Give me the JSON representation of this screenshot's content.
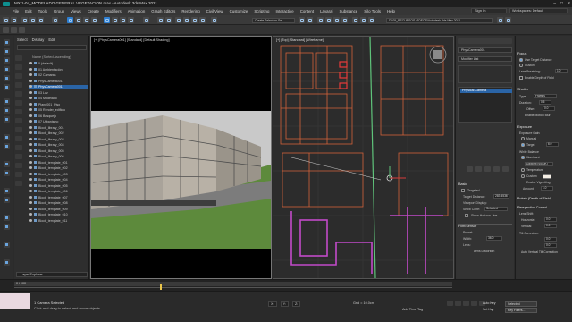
{
  "window": {
    "title": "MXI1-04_MODELADO GENERAL VEGETACION.max - Autodesk 3ds Max 2021"
  },
  "menu": [
    "File",
    "Edit",
    "Tools",
    "Group",
    "Views",
    "Create",
    "Modifiers",
    "Animation",
    "Graph Editors",
    "Rendering",
    "Civil View",
    "Customize",
    "Scripting",
    "Interactive",
    "Content",
    "Lavarai",
    "Substance",
    "Silo Tools",
    "Help"
  ],
  "header_controls": {
    "sign_in": "Sign In",
    "workspace": "Workspaces: Default"
  },
  "toolbar": {
    "selection_set": "Create Selection Set",
    "project_path": "D:\\05_RECURSOS VIDEOS\\Autodesk 3ds Max 2021"
  },
  "scene_explorer": {
    "tabs": [
      "Select",
      "Display",
      "Edit"
    ],
    "header": "Name (Sorted Ascending)",
    "rows": [
      {
        "label": "0 (default)",
        "selected": false
      },
      {
        "label": "01 Ambientación",
        "selected": false
      },
      {
        "label": "02 Cámaras",
        "selected": false
      },
      {
        "label": "PhysCamera001",
        "selected": false
      },
      {
        "label": "PhysCamera001",
        "selected": true
      },
      {
        "label": "03 Luz",
        "selected": false
      },
      {
        "label": "04 Modelado",
        "selected": false
      },
      {
        "label": "Plane001_Piso",
        "selected": false
      },
      {
        "label": "05 Render_edificio",
        "selected": false
      },
      {
        "label": "06 Bosquejo",
        "selected": false
      },
      {
        "label": "07 Urbanismo",
        "selected": false
      },
      {
        "label": "Block_library_001",
        "selected": false
      },
      {
        "label": "Block_library_002",
        "selected": false
      },
      {
        "label": "Block_library_003",
        "selected": false
      },
      {
        "label": "Block_library_004",
        "selected": false
      },
      {
        "label": "Block_library_005",
        "selected": false
      },
      {
        "label": "Block_library_006",
        "selected": false
      },
      {
        "label": "Block_template_001",
        "selected": false
      },
      {
        "label": "Block_template_002",
        "selected": false
      },
      {
        "label": "Block_template_003",
        "selected": false
      },
      {
        "label": "Block_template_004",
        "selected": false
      },
      {
        "label": "Block_template_005",
        "selected": false
      },
      {
        "label": "Block_template_006",
        "selected": false
      },
      {
        "label": "Block_template_007",
        "selected": false
      },
      {
        "label": "Block_template_008",
        "selected": false
      },
      {
        "label": "Block_template_009",
        "selected": false
      },
      {
        "label": "Block_template_010",
        "selected": false
      },
      {
        "label": "Block_template_011",
        "selected": false
      }
    ],
    "footer": "Layer Explorer"
  },
  "viewports": {
    "camera_label": "[+] [PhysCamera001] [Standard] [Default Shading]",
    "top_label": "[+] [Top] [Standard] [Wireframe]"
  },
  "command_panel": {
    "object_name": "PhysCamera001",
    "modifier_list": "Modifier List",
    "stack_item": "Physical Camera",
    "basic": {
      "header": "Basic",
      "targeted": "Targeted",
      "target_distance_label": "Target Distance:",
      "target_distance": "283.4536",
      "viewport_display": "Viewport Display:",
      "show_cone_label": "Show Cone:",
      "show_cone": "Selected",
      "show_horizon": "Show Horizon Line"
    },
    "film": {
      "header": "Film/Sensor",
      "preset_label": "Preset:",
      "width_label": "Width:",
      "width": "36.0",
      "lens_label": "Lens:",
      "lens": "Lens Distortion"
    }
  },
  "properties": {
    "focus_header": "Focus",
    "use_target_distance": "Use Target Distance",
    "custom": "Custom",
    "lens_breathing_label": "Lens Breathing:",
    "lens_breathing": "1.0",
    "enable_dof": "Enable Depth of Field",
    "shutter_header": "Shutter",
    "type_label": "Type:",
    "type_value": "Frames",
    "duration_label": "Duration:",
    "duration": "0.5",
    "offset_label": "Offset:",
    "offset": "0.0",
    "enable_motion_blur": "Enable Motion Blur",
    "exposure_header": "Exposure",
    "exposure_gain": "Exposure Gain:",
    "manual": "Manual",
    "target": "Target",
    "target_ev": "6.0",
    "white_balance": "White Balance",
    "illuminant": "Illuminant",
    "daylight": "Daylight (6500K)",
    "temperature": "Temperature",
    "custom_wb": "Custom",
    "enable_vignetting": "Enable Vignetting",
    "amount_label": "Amount:",
    "amount": "1.0",
    "bokeh_header": "Bokeh (Depth of Field)",
    "perspective_header": "Perspective Control",
    "lens_shift": "Lens Shift:",
    "horizontal_label": "Horizontal:",
    "horizontal": "0.0",
    "vertical_label": "Vertical:",
    "vertical": "0.0",
    "tilt_correction": "Tilt Correction:",
    "tilt_h": "0.0",
    "tilt_v": "0.0",
    "auto_vertical_tilt": "Auto Vertical Tilt Correction"
  },
  "timeline": {
    "frame": "0 / 100"
  },
  "status": {
    "selection": "1 Camera Selected",
    "prompt": "Click and drag to select and move objects",
    "x_label": "X:",
    "y_label": "Y:",
    "z_label": "Z:",
    "grid": "Grid = 10.0cm",
    "add_time_tag": "Add Time Tag",
    "auto_key": "Auto Key",
    "set_key": "Set Key",
    "selected": "Selected",
    "key_filters": "Key Filters..."
  },
  "colors": {
    "accent": "#2e7fd2",
    "selection": "#2a64a6",
    "grass": "#5d8a3c",
    "wire_orange": "#d2623a",
    "wire_magenta": "#c24ac9",
    "wire_green": "#5fc37a"
  }
}
